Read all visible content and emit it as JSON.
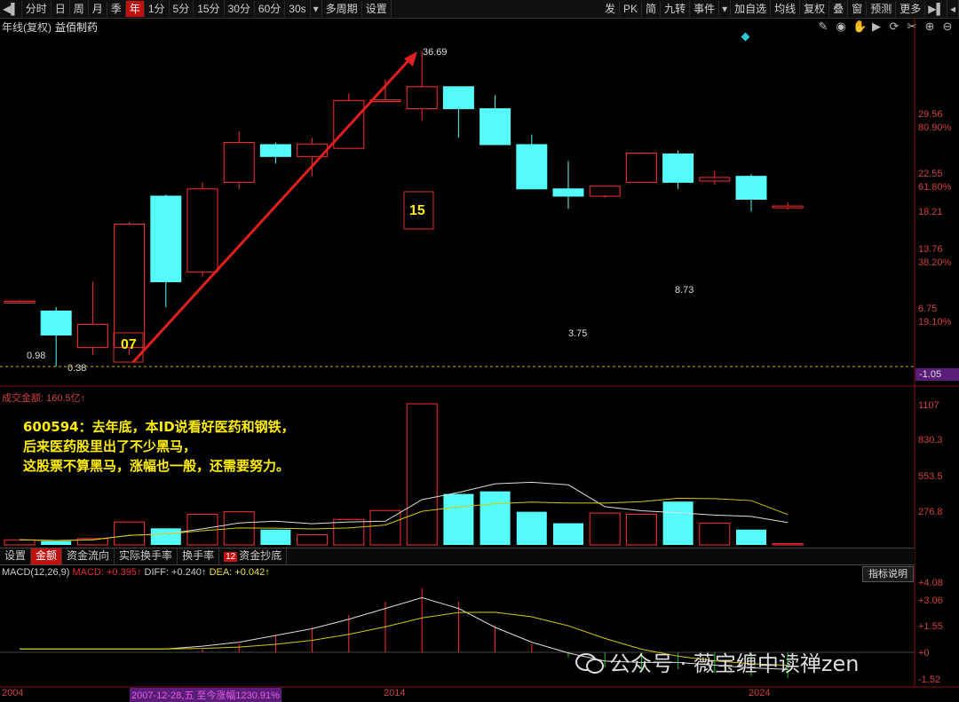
{
  "toolbar": {
    "left": [
      "分时",
      "日",
      "周",
      "月",
      "季",
      "年",
      "1分",
      "5分",
      "15分",
      "30分",
      "60分",
      "30s",
      "多周期",
      "设置"
    ],
    "active": "年",
    "right": [
      "发",
      "PK",
      "简",
      "九转",
      "事件",
      "加自选",
      "均线",
      "复权",
      "叠",
      "窗",
      "预测",
      "更多"
    ]
  },
  "title": {
    "mode": "年线(复权)",
    "stock": "益佰制药"
  },
  "price_labels": {
    "p1": "29.56",
    "p1pct": "80.90%",
    "p2": "22.55",
    "p2pct": "61.80%",
    "p3": "18.21",
    "p4": "13.76",
    "p4pct": "38.20%",
    "p5": "6.75",
    "p5pct": "19.10%",
    "base": "-1.05"
  },
  "candle_annotations": {
    "high": "36.69",
    "c1": "0.98",
    "c2": "0.38",
    "low": "3.75",
    "peak2": "8.73"
  },
  "box_labels": {
    "a": "07",
    "b": "15"
  },
  "volume": {
    "header": "成交金额: 160.5亿↑",
    "axis": [
      "1107",
      "830.3",
      "553.5",
      "276.8"
    ]
  },
  "annotation": {
    "line1": "600594：去年底，本ID说看好医药和钢铁，",
    "line2": "后来医药股里出了不少黑马，",
    "line3": "这股票不算黑马，涨幅也一般，还需要努力。"
  },
  "tabs": [
    "设置",
    "金额",
    "资金流向",
    "实际换手率",
    "换手率",
    "资金抄底"
  ],
  "tabs_active": "金额",
  "tab_badge": "12",
  "macd": {
    "label": "MACD(12,26,9)",
    "macd": "MACD: +0.395↑",
    "diff": "DIFF: +0.240↑",
    "dea": "DEA: +0.042↑",
    "axis": [
      "+4.08",
      "+3.06",
      "+1.55",
      "+0",
      "-1.52"
    ],
    "help": "指标说明"
  },
  "timeaxis": {
    "t1": "2004",
    "range": "2007-12-28,五 至今涨幅1230.91%",
    "t2": "2014",
    "t3": "2024"
  },
  "watermark": "公众号 · 薇宝缠中读禅zen",
  "colors": {
    "up": "#ff3030",
    "down": "#54fcfc",
    "bg": "#000000",
    "accent": "#c01010"
  },
  "chart_data": {
    "type": "candlestick",
    "candles": [
      {
        "o": 0.98,
        "c": 0.98,
        "h": 1.0,
        "l": 0.95
      },
      {
        "o": 0.85,
        "c": 0.6,
        "h": 0.9,
        "l": 0.38
      },
      {
        "o": 0.5,
        "c": 0.7,
        "h": 1.3,
        "l": 0.45
      },
      {
        "o": 0.5,
        "c": 3.0,
        "h": 3.1,
        "l": 0.45
      },
      {
        "o": 4.5,
        "c": 1.3,
        "h": 4.6,
        "l": 0.9
      },
      {
        "o": 1.5,
        "c": 5.0,
        "h": 5.5,
        "l": 1.4
      },
      {
        "o": 5.5,
        "c": 9.8,
        "h": 11.5,
        "l": 5.0
      },
      {
        "o": 9.5,
        "c": 8.0,
        "h": 9.8,
        "l": 7.2
      },
      {
        "o": 8.0,
        "c": 9.6,
        "h": 10.5,
        "l": 6.0
      },
      {
        "o": 9.0,
        "c": 18.0,
        "h": 20.0,
        "l": 9.0
      },
      {
        "o": 17.8,
        "c": 18.2,
        "h": 24.5,
        "l": 17.8
      },
      {
        "o": 16.0,
        "c": 22.0,
        "h": 36.69,
        "l": 13.5
      },
      {
        "o": 22.0,
        "c": 16.0,
        "h": 22.0,
        "l": 10.5
      },
      {
        "o": 16.0,
        "c": 9.5,
        "h": 19.5,
        "l": 9.5
      },
      {
        "o": 9.5,
        "c": 5.0,
        "h": 11.0,
        "l": 5.0
      },
      {
        "o": 5.0,
        "c": 4.5,
        "h": 7.5,
        "l": 3.75
      },
      {
        "o": 4.5,
        "c": 5.2,
        "h": 5.2,
        "l": 4.4
      },
      {
        "o": 5.5,
        "c": 8.4,
        "h": 8.5,
        "l": 5.5
      },
      {
        "o": 8.3,
        "c": 5.5,
        "h": 8.73,
        "l": 5.0
      },
      {
        "o": 5.6,
        "c": 5.9,
        "h": 6.5,
        "l": 5.3
      },
      {
        "o": 6.0,
        "c": 4.3,
        "h": 6.2,
        "l": 3.6
      },
      {
        "o": 3.8,
        "c": 3.9,
        "h": 4.1,
        "l": 3.7
      }
    ],
    "volume": [
      40,
      30,
      50,
      180,
      130,
      240,
      260,
      120,
      80,
      200,
      270,
      1107,
      400,
      420,
      260,
      170,
      250,
      240,
      340,
      170,
      120,
      10
    ],
    "macd_bars": [
      0,
      0,
      0,
      0,
      0,
      0.2,
      0.5,
      1.0,
      1.5,
      2.2,
      3.0,
      3.8,
      3.0,
      1.6,
      0.5,
      -0.3,
      -0.9,
      -1.0,
      -1.0,
      -1.2,
      -1.4,
      -1.52
    ]
  }
}
